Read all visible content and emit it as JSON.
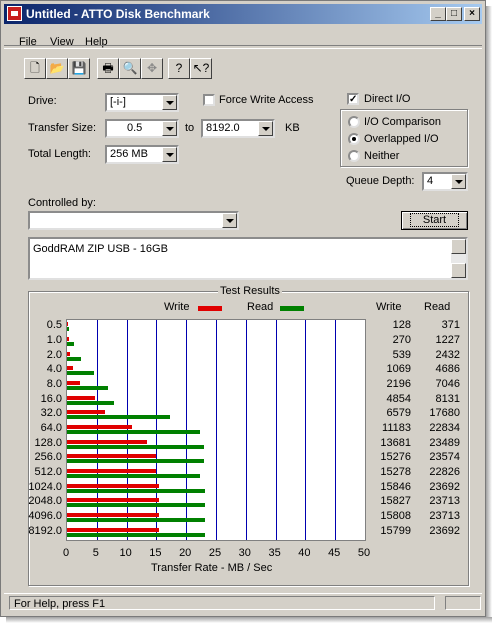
{
  "window": {
    "title": "Untitled - ATTO Disk Benchmark"
  },
  "menu": {
    "items": [
      "File",
      "View",
      "Help"
    ]
  },
  "toolbar": {
    "icons": [
      "new-icon",
      "open-icon",
      "save-icon",
      "print-icon",
      "print-preview-icon",
      "move-icon",
      "help-icon",
      "context-help-icon"
    ]
  },
  "form": {
    "drive_label": "Drive:",
    "drive_value": "[-i-]",
    "force_write_label": "Force Write Access",
    "force_write_checked": false,
    "direct_io_label": "Direct I/O",
    "direct_io_checked": true,
    "transfer_size_label": "Transfer Size:",
    "transfer_from": "0.5",
    "to_label": "to",
    "transfer_to": "8192.0",
    "kb_label": "KB",
    "total_length_label": "Total Length:",
    "total_length_value": "256 MB",
    "io_comparison_label": "I/O Comparison",
    "overlapped_io_label": "Overlapped I/O",
    "neither_label": "Neither",
    "selected_mode": "Overlapped I/O",
    "queue_depth_label": "Queue Depth:",
    "queue_depth_value": "4",
    "controlled_by_label": "Controlled by:",
    "controlled_by_value": "",
    "start_label": "Start",
    "description": "GoddRAM ZIP USB - 16GB"
  },
  "results": {
    "group_title": "Test Results",
    "legend_write": "Write",
    "legend_read": "Read",
    "col_write": "Write",
    "col_read": "Read",
    "write_color": "#e00000",
    "read_color": "#008000"
  },
  "chart_data": {
    "type": "bar",
    "orientation": "horizontal",
    "xlabel": "Transfer Rate - MB / Sec",
    "xlim": [
      0,
      50
    ],
    "xticks": [
      "0",
      "5",
      "10",
      "15",
      "20",
      "25",
      "30",
      "35",
      "40",
      "45",
      "50"
    ],
    "categories": [
      "0.5",
      "1.0",
      "2.0",
      "4.0",
      "8.0",
      "16.0",
      "32.0",
      "64.0",
      "128.0",
      "256.0",
      "512.0",
      "1024.0",
      "2048.0",
      "4096.0",
      "8192.0"
    ],
    "series": [
      {
        "name": "Write",
        "values": [
          0.125,
          0.264,
          0.526,
          1.044,
          2.145,
          4.74,
          6.425,
          10.921,
          13.36,
          14.918,
          14.92,
          15.475,
          15.456,
          15.438,
          15.429
        ]
      },
      {
        "name": "Read",
        "values": [
          0.362,
          1.198,
          2.375,
          4.576,
          6.881,
          7.94,
          17.266,
          22.299,
          22.938,
          23.021,
          22.291,
          23.137,
          23.157,
          23.157,
          23.137
        ]
      }
    ],
    "write_labels": [
      "128",
      "270",
      "539",
      "1069",
      "2196",
      "4854",
      "6579",
      "11183",
      "13681",
      "15276",
      "15278",
      "15846",
      "15827",
      "15808",
      "15799"
    ],
    "read_labels": [
      "371",
      "1227",
      "2432",
      "4686",
      "7046",
      "8131",
      "17680",
      "22834",
      "23489",
      "23574",
      "22826",
      "23692",
      "23713",
      "23713",
      "23692"
    ],
    "grid": true,
    "legend": "top"
  },
  "status": {
    "text": "For Help, press F1"
  }
}
